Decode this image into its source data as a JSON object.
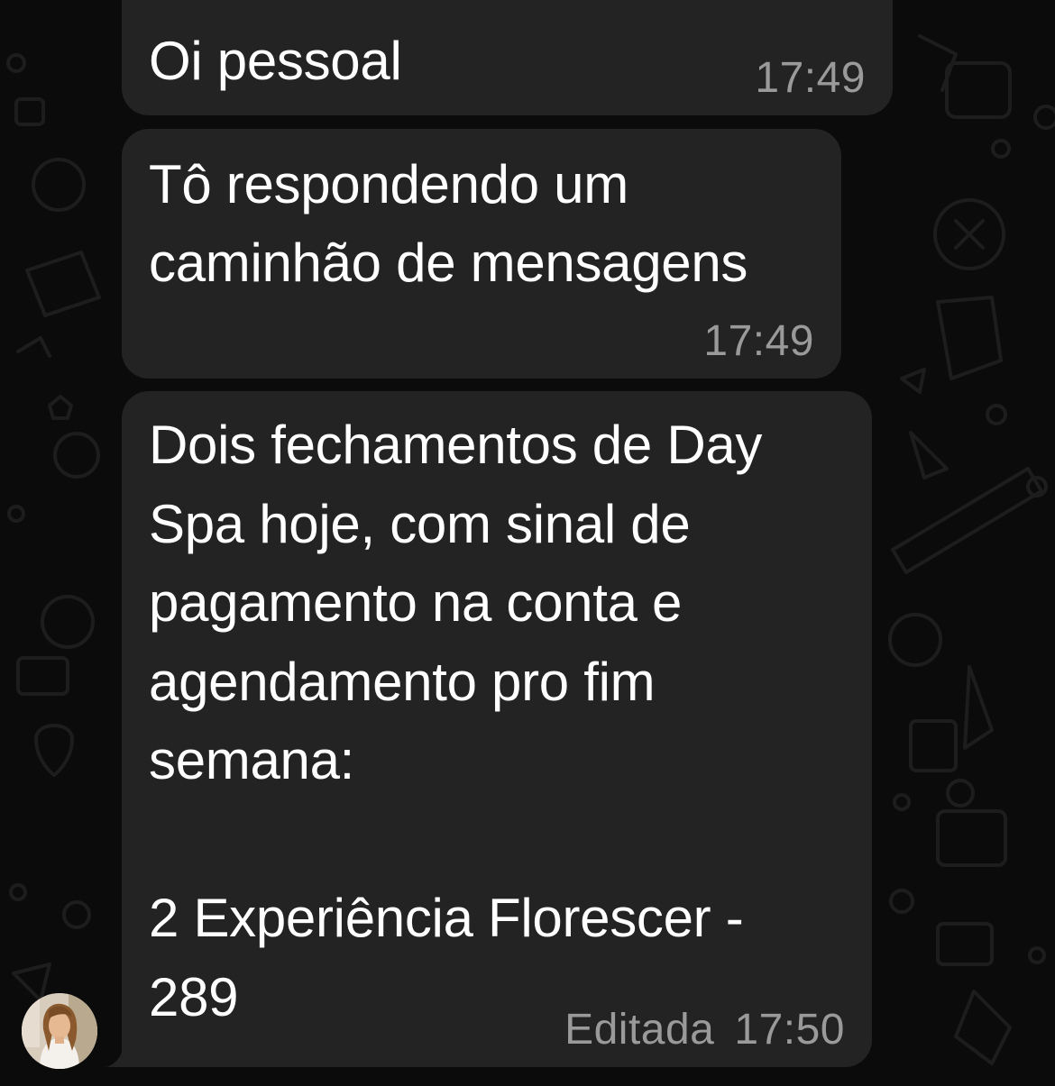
{
  "messages": [
    {
      "text": "Oi pessoal",
      "time": "17:49"
    },
    {
      "text": "Tô respondendo um\ncaminhão de mensagens",
      "time": "17:49"
    },
    {
      "text": "Dois fechamentos de Day\nSpa hoje, com sinal de\npagamento na conta e\nagendamento pro fim\nsemana:\n\n2 Experiência Florescer -\n289",
      "edited": "Editada",
      "time": "17:50"
    }
  ],
  "colors": {
    "background": "#0b0b0b",
    "bubble": "#232323",
    "text": "#ffffff",
    "timestamp": "#9a9a9a",
    "wallpaper_doodle": "#1c1c1c"
  },
  "avatar": {
    "icon": "contact-photo"
  }
}
